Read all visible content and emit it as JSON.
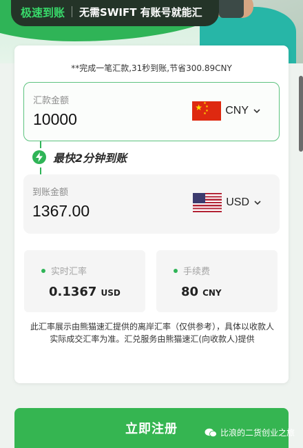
{
  "banner": {
    "highlight": "极速到账",
    "subtitle": "无需SWIFT 有账号就能汇"
  },
  "promo_text": "**完成一笔汇款,31秒到账,节省300.89CNY",
  "send": {
    "label": "汇款金额",
    "amount": "10000",
    "currency": "CNY",
    "flag_icon": "china-flag-icon"
  },
  "speed": {
    "text": "最快2分钟到账"
  },
  "receive": {
    "label": "到账金额",
    "amount": "1367.00",
    "currency": "USD",
    "flag_icon": "us-flag-icon"
  },
  "stats": {
    "rate": {
      "label": "实时汇率",
      "value": "0.1367",
      "unit": "USD"
    },
    "fee": {
      "label": "手续费",
      "value": "80",
      "unit": "CNY"
    }
  },
  "disclaimer": "此汇率展示由熊猫速汇提供的离岸汇率（仅供参考），具体以收款人实际成交汇率为准。汇兑服务由熊猫速汇(向收款人)提供",
  "register_label": "立即注册",
  "watermark": "比浪的二货创业之旅",
  "colors": {
    "accent": "#35b551",
    "field_border": "#5cc27e",
    "banner_pill": "#243428",
    "banner_highlight": "#38d96a"
  }
}
